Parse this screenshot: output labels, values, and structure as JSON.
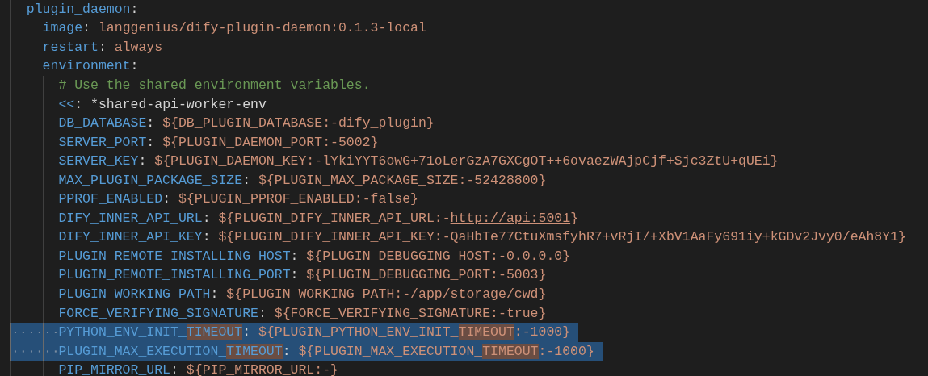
{
  "editor": {
    "lines": [
      {
        "selected": false,
        "parts": [
          {
            "text": "plugin_daemon",
            "kind": "key"
          },
          {
            "text": ":",
            "kind": "punct"
          }
        ],
        "children": [
          {
            "selected": false,
            "parts": [
              {
                "text": "image",
                "kind": "key"
              },
              {
                "text": ": ",
                "kind": "punct"
              },
              {
                "text": "langgenius/dify-plugin-daemon:0.1.3-local",
                "kind": "value"
              }
            ]
          },
          {
            "selected": false,
            "parts": [
              {
                "text": "restart",
                "kind": "key"
              },
              {
                "text": ": ",
                "kind": "punct"
              },
              {
                "text": "always",
                "kind": "value"
              }
            ]
          },
          {
            "selected": false,
            "parts": [
              {
                "text": "environment",
                "kind": "key"
              },
              {
                "text": ":",
                "kind": "punct"
              }
            ],
            "children": [
              {
                "selected": false,
                "parts": [
                  {
                    "text": "# Use the shared environment variables.",
                    "kind": "comment"
                  }
                ]
              },
              {
                "selected": false,
                "parts": [
                  {
                    "text": "<<",
                    "kind": "key"
                  },
                  {
                    "text": ": ",
                    "kind": "punct"
                  },
                  {
                    "text": "*shared-api-worker-env",
                    "kind": "anchor"
                  }
                ]
              },
              {
                "selected": false,
                "parts": [
                  {
                    "text": "DB_DATABASE",
                    "kind": "key"
                  },
                  {
                    "text": ": ",
                    "kind": "punct"
                  },
                  {
                    "text": "${DB_PLUGIN_DATABASE:-dify_plugin}",
                    "kind": "value"
                  }
                ]
              },
              {
                "selected": false,
                "parts": [
                  {
                    "text": "SERVER_PORT",
                    "kind": "key"
                  },
                  {
                    "text": ": ",
                    "kind": "punct"
                  },
                  {
                    "text": "${PLUGIN_DAEMON_PORT:-5002}",
                    "kind": "value"
                  }
                ]
              },
              {
                "selected": false,
                "parts": [
                  {
                    "text": "SERVER_KEY",
                    "kind": "key"
                  },
                  {
                    "text": ": ",
                    "kind": "punct"
                  },
                  {
                    "text": "${PLUGIN_DAEMON_KEY:-lYkiYYT6owG+71oLerGzA7GXCgOT++6ovaezWAjpCjf+Sjc3ZtU+qUEi}",
                    "kind": "value"
                  }
                ]
              },
              {
                "selected": false,
                "parts": [
                  {
                    "text": "MAX_PLUGIN_PACKAGE_SIZE",
                    "kind": "key"
                  },
                  {
                    "text": ": ",
                    "kind": "punct"
                  },
                  {
                    "text": "${PLUGIN_MAX_PACKAGE_SIZE:-52428800}",
                    "kind": "value"
                  }
                ]
              },
              {
                "selected": false,
                "parts": [
                  {
                    "text": "PPROF_ENABLED",
                    "kind": "key"
                  },
                  {
                    "text": ": ",
                    "kind": "punct"
                  },
                  {
                    "text": "${PLUGIN_PPROF_ENABLED:-false}",
                    "kind": "value"
                  }
                ]
              },
              {
                "selected": false,
                "parts": [
                  {
                    "text": "DIFY_INNER_API_URL",
                    "kind": "key"
                  },
                  {
                    "text": ": ",
                    "kind": "punct"
                  },
                  {
                    "text": "${PLUGIN_DIFY_INNER_API_URL:-",
                    "kind": "value"
                  },
                  {
                    "text": "http://api:5001",
                    "kind": "link"
                  },
                  {
                    "text": "}",
                    "kind": "value"
                  }
                ]
              },
              {
                "selected": false,
                "parts": [
                  {
                    "text": "DIFY_INNER_API_KEY",
                    "kind": "key"
                  },
                  {
                    "text": ": ",
                    "kind": "punct"
                  },
                  {
                    "text": "${PLUGIN_DIFY_INNER_API_KEY:-QaHbTe77CtuXmsfyhR7+vRjI/+XbV1AaFy691iy+kGDv2Jvy0/eAh8Y1}",
                    "kind": "value"
                  }
                ]
              },
              {
                "selected": false,
                "parts": [
                  {
                    "text": "PLUGIN_REMOTE_INSTALLING_HOST",
                    "kind": "key"
                  },
                  {
                    "text": ": ",
                    "kind": "punct"
                  },
                  {
                    "text": "${PLUGIN_DEBUGGING_HOST:-0.0.0.0}",
                    "kind": "value"
                  }
                ]
              },
              {
                "selected": false,
                "parts": [
                  {
                    "text": "PLUGIN_REMOTE_INSTALLING_PORT",
                    "kind": "key"
                  },
                  {
                    "text": ": ",
                    "kind": "punct"
                  },
                  {
                    "text": "${PLUGIN_DEBUGGING_PORT:-5003}",
                    "kind": "value"
                  }
                ]
              },
              {
                "selected": false,
                "parts": [
                  {
                    "text": "PLUGIN_WORKING_PATH",
                    "kind": "key"
                  },
                  {
                    "text": ": ",
                    "kind": "punct"
                  },
                  {
                    "text": "${PLUGIN_WORKING_PATH:-/app/storage/cwd}",
                    "kind": "value"
                  }
                ]
              },
              {
                "selected": false,
                "parts": [
                  {
                    "text": "FORCE_VERIFYING_SIGNATURE",
                    "kind": "key"
                  },
                  {
                    "text": ": ",
                    "kind": "punct"
                  },
                  {
                    "text": "${FORCE_VERIFYING_SIGNATURE:-true}",
                    "kind": "value"
                  }
                ]
              },
              {
                "selected": true,
                "parts": [
                  {
                    "text": "PYTHON_ENV_INIT_",
                    "kind": "key"
                  },
                  {
                    "text": "TIMEOUT",
                    "kind": "key",
                    "match": true
                  },
                  {
                    "text": ": ",
                    "kind": "punct"
                  },
                  {
                    "text": "${PLUGIN_PYTHON_ENV_INIT_",
                    "kind": "value"
                  },
                  {
                    "text": "TIMEOUT",
                    "kind": "value",
                    "match": true
                  },
                  {
                    "text": ":-1000}",
                    "kind": "value"
                  }
                ]
              },
              {
                "selected": true,
                "parts": [
                  {
                    "text": "PLUGIN_MAX_EXECUTION_",
                    "kind": "key"
                  },
                  {
                    "text": "TIMEOUT",
                    "kind": "key",
                    "match": true
                  },
                  {
                    "text": ": ",
                    "kind": "punct"
                  },
                  {
                    "text": "${PLUGIN_MAX_EXECUTION_",
                    "kind": "value"
                  },
                  {
                    "text": "TIMEOUT",
                    "kind": "value",
                    "match": true
                  },
                  {
                    "text": ":-1000}",
                    "kind": "value"
                  }
                ]
              },
              {
                "selected": false,
                "parts": [
                  {
                    "text": "PIP_MIRROR_URL",
                    "kind": "key"
                  },
                  {
                    "text": ": ",
                    "kind": "punct"
                  },
                  {
                    "text": "${PIP_MIRROR_URL:-}",
                    "kind": "value"
                  }
                ]
              }
            ]
          }
        ]
      }
    ]
  }
}
